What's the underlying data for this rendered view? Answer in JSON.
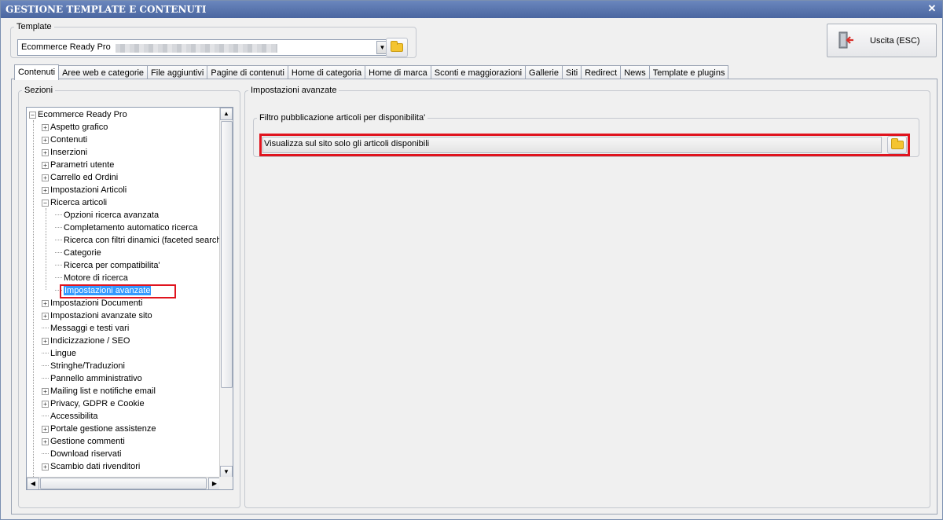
{
  "window": {
    "title": "GESTIONE TEMPLATE E CONTENUTI",
    "close_glyph": "✕"
  },
  "template": {
    "legend": "Template",
    "selected": "Ecommerce Ready Pro",
    "dropdown_glyph": "▼",
    "browse_icon": "folder-icon"
  },
  "exit_button": {
    "label": "Uscita (ESC)",
    "icon": "exit-door-icon"
  },
  "tabs": [
    {
      "label": "Contenuti",
      "active": true
    },
    {
      "label": "Aree web e categorie"
    },
    {
      "label": "File aggiuntivi"
    },
    {
      "label": "Pagine di contenuti"
    },
    {
      "label": "Home di categoria"
    },
    {
      "label": "Home di marca"
    },
    {
      "label": "Sconti e maggiorazioni"
    },
    {
      "label": "Gallerie"
    },
    {
      "label": "Siti"
    },
    {
      "label": "Redirect"
    },
    {
      "label": "News"
    },
    {
      "label": "Template e plugins"
    }
  ],
  "sections": {
    "legend": "Sezioni",
    "root": "Ecommerce Ready Pro",
    "items": [
      {
        "label": "Aspetto grafico",
        "level": 1,
        "toggle": "+"
      },
      {
        "label": "Contenuti",
        "level": 1,
        "toggle": "+"
      },
      {
        "label": "Inserzioni",
        "level": 1,
        "toggle": "+"
      },
      {
        "label": "Parametri utente",
        "level": 1,
        "toggle": "+"
      },
      {
        "label": "Carrello ed Ordini",
        "level": 1,
        "toggle": "+"
      },
      {
        "label": "Impostazioni Articoli",
        "level": 1,
        "toggle": "+"
      },
      {
        "label": "Ricerca articoli",
        "level": 1,
        "toggle": "-"
      },
      {
        "label": "Opzioni ricerca avanzata",
        "level": 2
      },
      {
        "label": "Completamento automatico ricerca",
        "level": 2
      },
      {
        "label": "Ricerca con filtri dinamici (faceted search)",
        "level": 2
      },
      {
        "label": "Categorie",
        "level": 2
      },
      {
        "label": "Ricerca per compatibilita'",
        "level": 2
      },
      {
        "label": "Motore di ricerca",
        "level": 2
      },
      {
        "label": "Impostazioni avanzate",
        "level": 2,
        "selected": true
      },
      {
        "label": "Impostazioni Documenti",
        "level": 1,
        "toggle": "+"
      },
      {
        "label": "Impostazioni avanzate sito",
        "level": 1,
        "toggle": "+"
      },
      {
        "label": "Messaggi e testi vari",
        "level": 1
      },
      {
        "label": "Indicizzazione / SEO",
        "level": 1,
        "toggle": "+"
      },
      {
        "label": "Lingue",
        "level": 1
      },
      {
        "label": "Stringhe/Traduzioni",
        "level": 1
      },
      {
        "label": "Pannello amministrativo",
        "level": 1
      },
      {
        "label": "Mailing list e notifiche email",
        "level": 1,
        "toggle": "+"
      },
      {
        "label": "Privacy, GDPR e Cookie",
        "level": 1,
        "toggle": "+"
      },
      {
        "label": "Accessibilita",
        "level": 1
      },
      {
        "label": "Portale gestione assistenze",
        "level": 1,
        "toggle": "+"
      },
      {
        "label": "Gestione commenti",
        "level": 1,
        "toggle": "+"
      },
      {
        "label": "Download riservati",
        "level": 1
      },
      {
        "label": "Scambio dati rivenditori",
        "level": 1,
        "toggle": "+"
      }
    ],
    "scroll_up": "▲",
    "scroll_down": "▼",
    "scroll_left": "◀",
    "scroll_right": "▶"
  },
  "advanced": {
    "legend": "Impostazioni avanzate",
    "filter": {
      "legend": "Filtro pubblicazione articoli per disponibilita'",
      "value": "Visualizza sul sito solo gli articoli disponibili",
      "browse_icon": "folder-icon"
    }
  },
  "colors": {
    "title_bar": "#4a66a0",
    "highlight": "#e0141e",
    "selection": "#3399ff"
  }
}
